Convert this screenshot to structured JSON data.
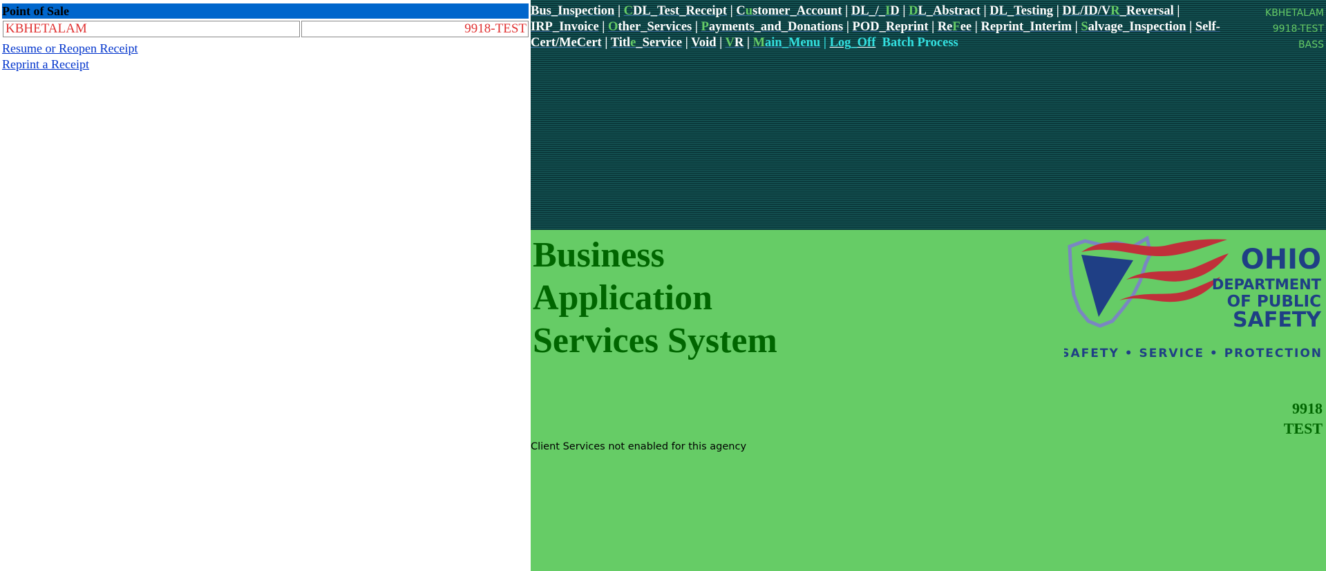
{
  "pos": {
    "header": "Point of Sale",
    "user": "KBHETALAM",
    "agency": "9918-TEST",
    "links": {
      "resume": "Resume or Reopen Receipt",
      "reprint": "Reprint a Receipt"
    }
  },
  "menu": {
    "items": [
      {
        "pre": "",
        "key": "",
        "post": "Bus_Inspection"
      },
      {
        "pre": "",
        "key": "C",
        "post": "DL_Test_Receipt"
      },
      {
        "pre": "C",
        "key": "u",
        "post": "stomer_Account"
      },
      {
        "pre": "DL_/_",
        "key": "I",
        "post": "D"
      },
      {
        "pre": "",
        "key": "D",
        "post": "L_Abstract"
      },
      {
        "pre": "DL_Testing",
        "key": "",
        "post": ""
      },
      {
        "pre": "DL/ID/V",
        "key": "R",
        "post": "_Reversal"
      },
      {
        "pre": "IRP_Invoice",
        "key": "",
        "post": ""
      },
      {
        "pre": "",
        "key": "O",
        "post": "ther_Services"
      },
      {
        "pre": "",
        "key": "P",
        "post": "ayments_and_Donations"
      },
      {
        "pre": "POD_Reprint",
        "key": "",
        "post": ""
      },
      {
        "pre": "Re",
        "key": "F",
        "post": "ee"
      },
      {
        "pre": "Reprint_Interim",
        "key": "",
        "post": ""
      },
      {
        "pre": "",
        "key": "S",
        "post": "alvage_Inspection"
      },
      {
        "pre": "Self-Cert/MeCert",
        "key": "",
        "post": ""
      },
      {
        "pre": "Titl",
        "key": "e",
        "post": "_Service"
      },
      {
        "pre": "Void",
        "key": "",
        "post": ""
      },
      {
        "pre": "",
        "key": "V",
        "post": "R"
      }
    ],
    "main_menu": {
      "key": "M",
      "post": "ain_Menu"
    },
    "log_off": "Log_Off",
    "batch": "Batch Process",
    "info": {
      "user": "KBHETALAM",
      "agency": "9918-TEST",
      "system": "BASS"
    },
    "colors": {
      "accent_green": "#66cc66",
      "cyan": "#33e0e0",
      "background": "#0b3a3c"
    }
  },
  "home": {
    "title_lines": [
      "Business",
      "Application",
      "Services System"
    ],
    "logo": {
      "name": "ohio-dps-logo",
      "line1": "OHIO",
      "line2": "DEPARTMENT",
      "line3": "OF PUBLIC",
      "line4": "SAFETY",
      "tagline": "SAFETY  •  SERVICE  •  PROTECTION"
    },
    "agency_number": "9918",
    "agency_name": "TEST",
    "client_message": "Client Services not enabled for this agency",
    "colors": {
      "background": "#66cc66",
      "title": "#006600"
    }
  }
}
